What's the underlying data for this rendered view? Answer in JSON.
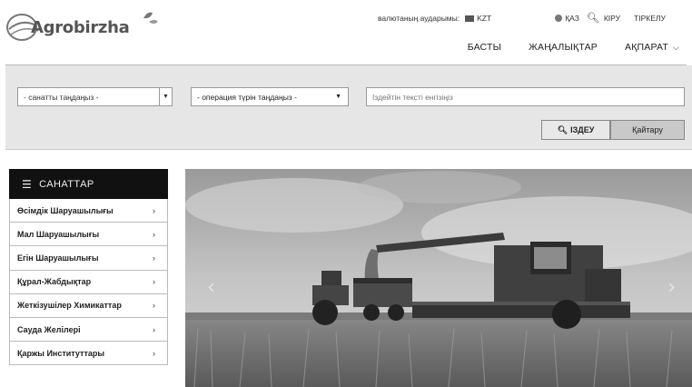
{
  "header": {
    "logo_text": "Agrobirzha",
    "currency_label": "валютаның аударымы:",
    "currency_code": "KZT",
    "language": "ҚАЗ",
    "login": "КІРУ",
    "register": "ТІРКЕЛУ",
    "nav": [
      {
        "label": "БАСТЫ"
      },
      {
        "label": "ЖАҢАЛЫҚТАР"
      },
      {
        "label": "АҚПАРАТ"
      }
    ]
  },
  "search": {
    "category_select": "- санатты таңдаңыз -",
    "operation_select": "- операция түрін таңдаңыз -",
    "query_placeholder": "Іздейтін тексті енгізіңіз",
    "search_button": "ІЗДЕУ",
    "reset_button": "Қайтару"
  },
  "sidebar": {
    "title": "САНАТТАР",
    "items": [
      {
        "label": "Өсімдік Шаруашылығы"
      },
      {
        "label": "Мал Шаруашылығы"
      },
      {
        "label": "Егін Шаруашылығы"
      },
      {
        "label": "Құрал-Жабдықтар"
      },
      {
        "label": "Жеткізушілер Химикаттар"
      },
      {
        "label": "Сауда Желілері"
      },
      {
        "label": "Қаржы Институттары"
      }
    ]
  },
  "icons": {
    "currency_flag": "flag-icon",
    "language": "globe-icon",
    "search": "search-icon",
    "menu": "hamburger-icon",
    "chevron": "chevron-right-icon"
  },
  "colors": {
    "sidebar_header_bg": "#111111",
    "search_panel_bg": "#e6e6e6",
    "reset_button_bg": "#c9c9c9"
  }
}
